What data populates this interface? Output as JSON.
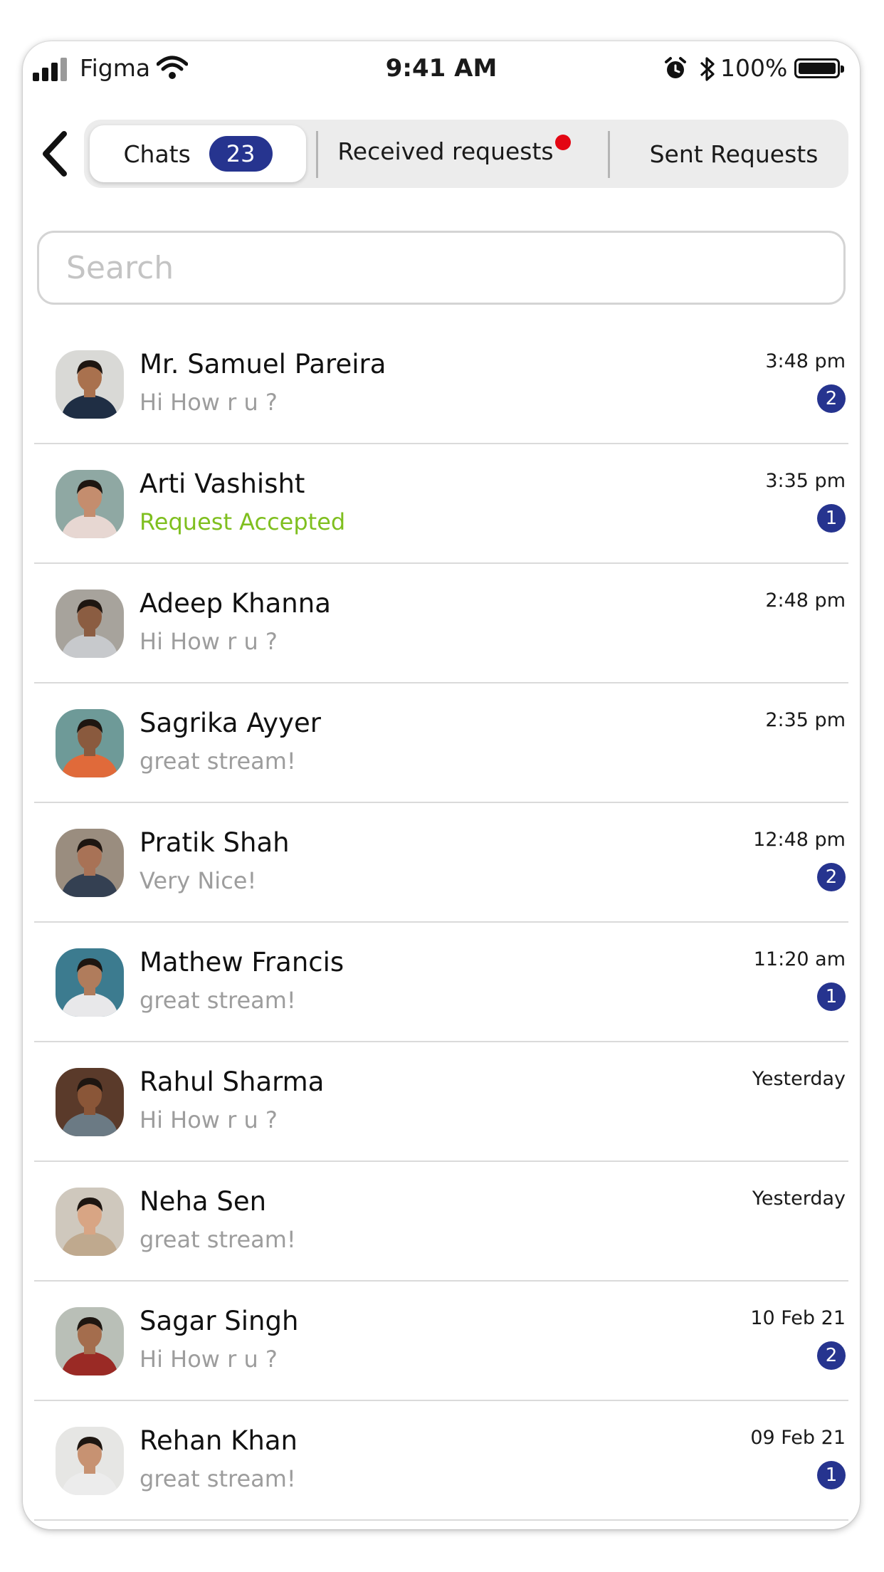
{
  "status_bar": {
    "carrier": "Figma",
    "time": "9:41 AM",
    "battery_percent": "100%"
  },
  "tabs": {
    "chats_label": "Chats",
    "chats_count": "23",
    "received_label": "Received requests",
    "received_has_dot": true,
    "sent_label": "Sent Requests"
  },
  "search": {
    "placeholder": "Search"
  },
  "chats": [
    {
      "name": "Mr. Samuel Pareira",
      "message": "Hi How r u ?",
      "time": "3:48 pm",
      "unread": "2",
      "accent": false,
      "avatar_bg": "#d9d9d6",
      "skin": "#a9714e",
      "shirt": "#1f2e44"
    },
    {
      "name": "Arti Vashisht",
      "message": "Request Accepted",
      "time": "3:35 pm",
      "unread": "1",
      "accent": true,
      "avatar_bg": "#8fa8a3",
      "skin": "#c48d6e",
      "shirt": "#e7d7d2"
    },
    {
      "name": "Adeep Khanna",
      "message": "Hi How r u ?",
      "time": "2:48 pm",
      "unread": "",
      "accent": false,
      "avatar_bg": "#a7a39c",
      "skin": "#8b5d42",
      "shirt": "#c7c9cc"
    },
    {
      "name": "Sagrika Ayyer",
      "message": "great stream!",
      "time": "2:35 pm",
      "unread": "",
      "accent": false,
      "avatar_bg": "#6e9a98",
      "skin": "#8a5a3e",
      "shirt": "#e06a3a"
    },
    {
      "name": "Pratik Shah",
      "message": "Very Nice!",
      "time": "12:48 pm",
      "unread": "2",
      "accent": false,
      "avatar_bg": "#9a8d7f",
      "skin": "#a87256",
      "shirt": "#344052"
    },
    {
      "name": "Mathew Francis",
      "message": "great stream!",
      "time": "11:20 am",
      "unread": "1",
      "accent": false,
      "avatar_bg": "#3c7b8f",
      "skin": "#b07c5c",
      "shirt": "#e8e8ea"
    },
    {
      "name": "Rahul Sharma",
      "message": "Hi How r u ?",
      "time": "Yesterday",
      "unread": "",
      "accent": false,
      "avatar_bg": "#5a3a2a",
      "skin": "#8a5638",
      "shirt": "#6b7a84"
    },
    {
      "name": "Neha Sen",
      "message": "great stream!",
      "time": "Yesterday",
      "unread": "",
      "accent": false,
      "avatar_bg": "#cfc8bd",
      "skin": "#d8a584",
      "shirt": "#bfa98e"
    },
    {
      "name": "Sagar Singh",
      "message": "Hi How r u ?",
      "time": "10 Feb 21",
      "unread": "2",
      "accent": false,
      "avatar_bg": "#b9bfb7",
      "skin": "#a46d4d",
      "shirt": "#9a2a25"
    },
    {
      "name": "Rehan Khan",
      "message": "great stream!",
      "time": "09 Feb 21",
      "unread": "1",
      "accent": false,
      "avatar_bg": "#e6e6e4",
      "skin": "#c79272",
      "shirt": "#ececec"
    }
  ],
  "colors": {
    "accent": "#26348f",
    "success": "#7fbf1f",
    "notification_dot": "#e30613"
  },
  "icons": {
    "back": "chevron-left-icon",
    "wifi": "wifi-icon",
    "alarm": "alarm-clock-icon",
    "bluetooth": "bluetooth-icon",
    "battery": "battery-icon"
  }
}
